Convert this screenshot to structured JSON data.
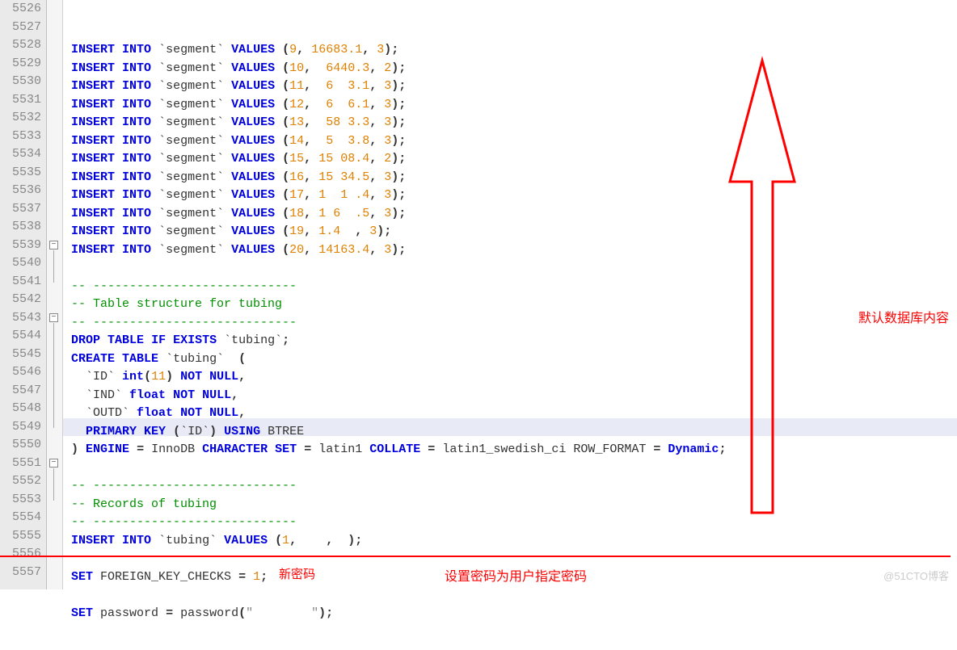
{
  "lines": [
    {
      "num": "5526"
    },
    {
      "num": "5527"
    },
    {
      "num": "5528"
    },
    {
      "num": "5529"
    },
    {
      "num": "5530"
    },
    {
      "num": "5531"
    },
    {
      "num": "5532"
    },
    {
      "num": "5533"
    },
    {
      "num": "5534"
    },
    {
      "num": "5535"
    },
    {
      "num": "5536"
    },
    {
      "num": "5537"
    },
    {
      "num": "5538"
    },
    {
      "num": "5539"
    },
    {
      "num": "5540"
    },
    {
      "num": "5541"
    },
    {
      "num": "5542"
    },
    {
      "num": "5543"
    },
    {
      "num": "5544"
    },
    {
      "num": "5545"
    },
    {
      "num": "5546"
    },
    {
      "num": "5547"
    },
    {
      "num": "5548"
    },
    {
      "num": "5549"
    },
    {
      "num": "5550"
    },
    {
      "num": "5551"
    },
    {
      "num": "5552"
    },
    {
      "num": "5553"
    },
    {
      "num": "5554"
    },
    {
      "num": "5555"
    },
    {
      "num": "5556"
    },
    {
      "num": "5557"
    }
  ],
  "code": {
    "inserts": [
      {
        "v1": "9",
        "v2": "16683.1",
        "v3": "3"
      },
      {
        "v1": "10",
        "v2": " 6440.3",
        "v3": "2"
      },
      {
        "v1": "11",
        "v2": " 6  3.1",
        "v3": "3"
      },
      {
        "v1": "12",
        "v2": " 6  6.1",
        "v3": "3"
      },
      {
        "v1": "13",
        "v2": " 58 3.3",
        "v3": "3"
      },
      {
        "v1": "14",
        "v2": " 5  3.8",
        "v3": "3"
      },
      {
        "v1": "15",
        "v2": "15 08.4",
        "v3": "2"
      },
      {
        "v1": "16",
        "v2": "15 34.5",
        "v3": "3"
      },
      {
        "v1": "17",
        "v2": "1  1 .4",
        "v3": "3"
      },
      {
        "v1": "18",
        "v2": "1 6  .5",
        "v3": "3"
      },
      {
        "v1": "19",
        "v2": "1.4  ",
        "v3": "3"
      },
      {
        "v1": "20",
        "v2": "14163.4",
        "v3": "3"
      }
    ],
    "comment_sep": "-- ----------------------------",
    "comment_table": "-- Table structure for tubing",
    "drop_table": {
      "kw1": "DROP",
      "kw2": "TABLE",
      "kw3": "IF",
      "kw4": "EXISTS",
      "name": "`tubing`"
    },
    "create_table": {
      "kw1": "CREATE",
      "kw2": "TABLE",
      "name": "`tubing`"
    },
    "col_id": {
      "name": "`ID`",
      "type": "int",
      "size": "11",
      "kw1": "NOT",
      "kw2": "NULL"
    },
    "col_ind": {
      "name": "`IND`",
      "type": "float",
      "kw1": "NOT",
      "kw2": "NULL"
    },
    "col_outd": {
      "name": "`OUTD`",
      "type": "float",
      "kw1": "NOT",
      "kw2": "NULL"
    },
    "pk": {
      "kw1": "PRIMARY",
      "kw2": "KEY",
      "col": "`ID`",
      "kw3": "USING",
      "idx": "BTREE"
    },
    "engine_line": {
      "kw_eng": "ENGINE",
      "val_eng": "InnoDB",
      "kw_cs": "CHARACTER",
      "kw_set": "SET",
      "val_cs": "latin1",
      "kw_col": "COLLATE",
      "val_col": "latin1_swedish_ci",
      "kw_rf": "ROW_FORMAT",
      "val_rf": "Dynamic"
    },
    "comment_records": "-- Records of tubing",
    "insert_tubing": {
      "kw1": "INSERT",
      "kw2": "INTO",
      "name": "`tubing`",
      "kw3": "VALUES",
      "v1": "1",
      "v2": "   ",
      "v3": " "
    },
    "set_fk": {
      "kw": "SET",
      "var": "FOREIGN_KEY_CHECKS",
      "val": "1"
    },
    "set_pwd": {
      "kw": "SET",
      "var": "password",
      "fn": "password",
      "arg": "\"        \""
    }
  },
  "annotations": {
    "right": "默认数据库内容",
    "bottom": "设置密码为用户指定密码",
    "pwd_label": "新密码",
    "watermark": "@51CTO博客"
  }
}
